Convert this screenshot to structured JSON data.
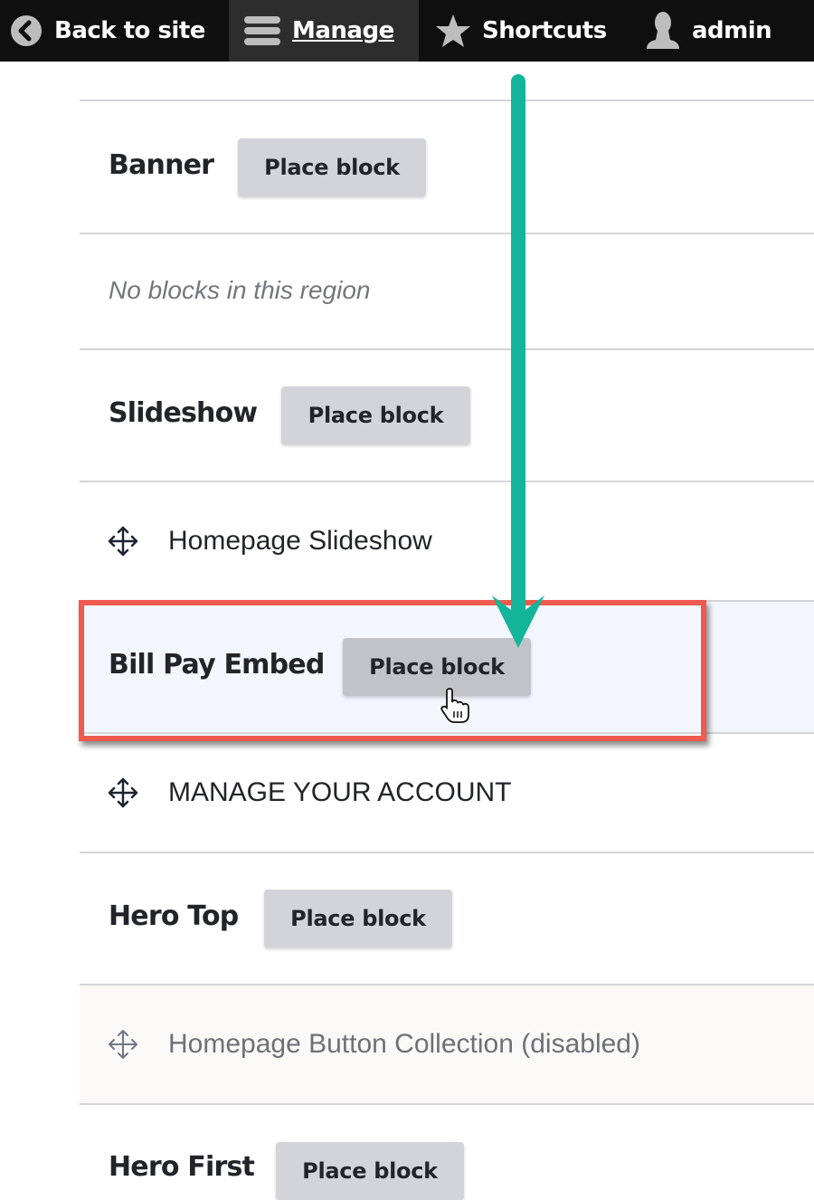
{
  "toolbar": {
    "back": {
      "label": "Back to site",
      "icon": "chevron-left-circle-icon"
    },
    "manage": {
      "label": "Manage",
      "icon": "hamburger-menu-icon",
      "active": true
    },
    "shortcuts": {
      "label": "Shortcuts",
      "icon": "star-icon"
    },
    "user": {
      "label": "admin",
      "icon": "user-icon"
    }
  },
  "regions": [
    {
      "title": "Banner",
      "button": "Place block",
      "blocks": [],
      "empty_text": "No blocks in this region"
    },
    {
      "title": "Slideshow",
      "button": "Place block",
      "blocks": [
        {
          "label": "Homepage Slideshow",
          "disabled": false
        }
      ]
    },
    {
      "title": "Bill Pay Embed",
      "button": "Place block",
      "highlighted": true,
      "blocks": [
        {
          "label": "MANAGE YOUR ACCOUNT",
          "disabled": false
        }
      ]
    },
    {
      "title": "Hero Top",
      "button": "Place block",
      "blocks": [
        {
          "label": "Homepage Button Collection (disabled)",
          "disabled": true
        }
      ]
    },
    {
      "title": "Hero First",
      "button": "Place block",
      "blocks": []
    }
  ],
  "annotation": {
    "arrow_color": "#13b59b",
    "highlight_color": "#ef5a4f"
  }
}
